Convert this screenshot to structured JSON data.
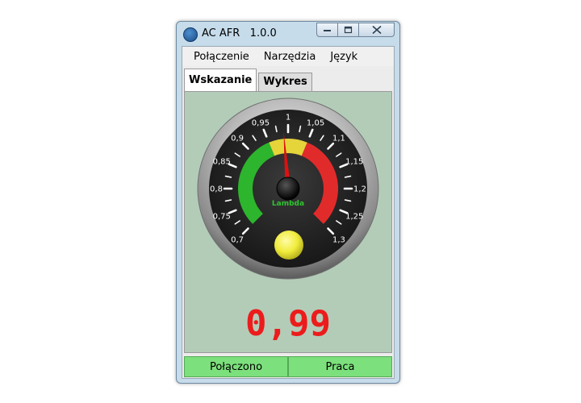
{
  "window": {
    "title": "AC AFR   1.0.0",
    "icon": "app-lambda-icon",
    "buttons": {
      "minimize": "minimize-icon",
      "maximize": "maximize-icon",
      "close": "close-icon"
    }
  },
  "menu": {
    "items": [
      "Połączenie",
      "Narzędzia",
      "Język"
    ]
  },
  "tabs": [
    {
      "label": "Wskazanie",
      "active": true
    },
    {
      "label": "Wykres",
      "active": false
    }
  ],
  "gauge": {
    "tick_labels": [
      "0,7",
      "0,75",
      "0,8",
      "0,85",
      "0,9",
      "0,95",
      "1",
      "1,05",
      "1,1",
      "1,15",
      "1,2",
      "1,25",
      "1,3"
    ],
    "min": 0.7,
    "max": 1.3,
    "value": 0.99,
    "center_label": "Lambda",
    "zones": [
      {
        "from": 0.7,
        "to": 0.95,
        "color": "#2db52d"
      },
      {
        "from": 0.95,
        "to": 1.05,
        "color": "#e5d43a"
      },
      {
        "from": 1.05,
        "to": 1.3,
        "color": "#e12b2b"
      }
    ],
    "indicator_color": "#f2ef45",
    "needle_color": "#e01010"
  },
  "readout": "0,99",
  "status": {
    "left": "Połączono",
    "right": "Praca",
    "color": "#7ce07c"
  }
}
